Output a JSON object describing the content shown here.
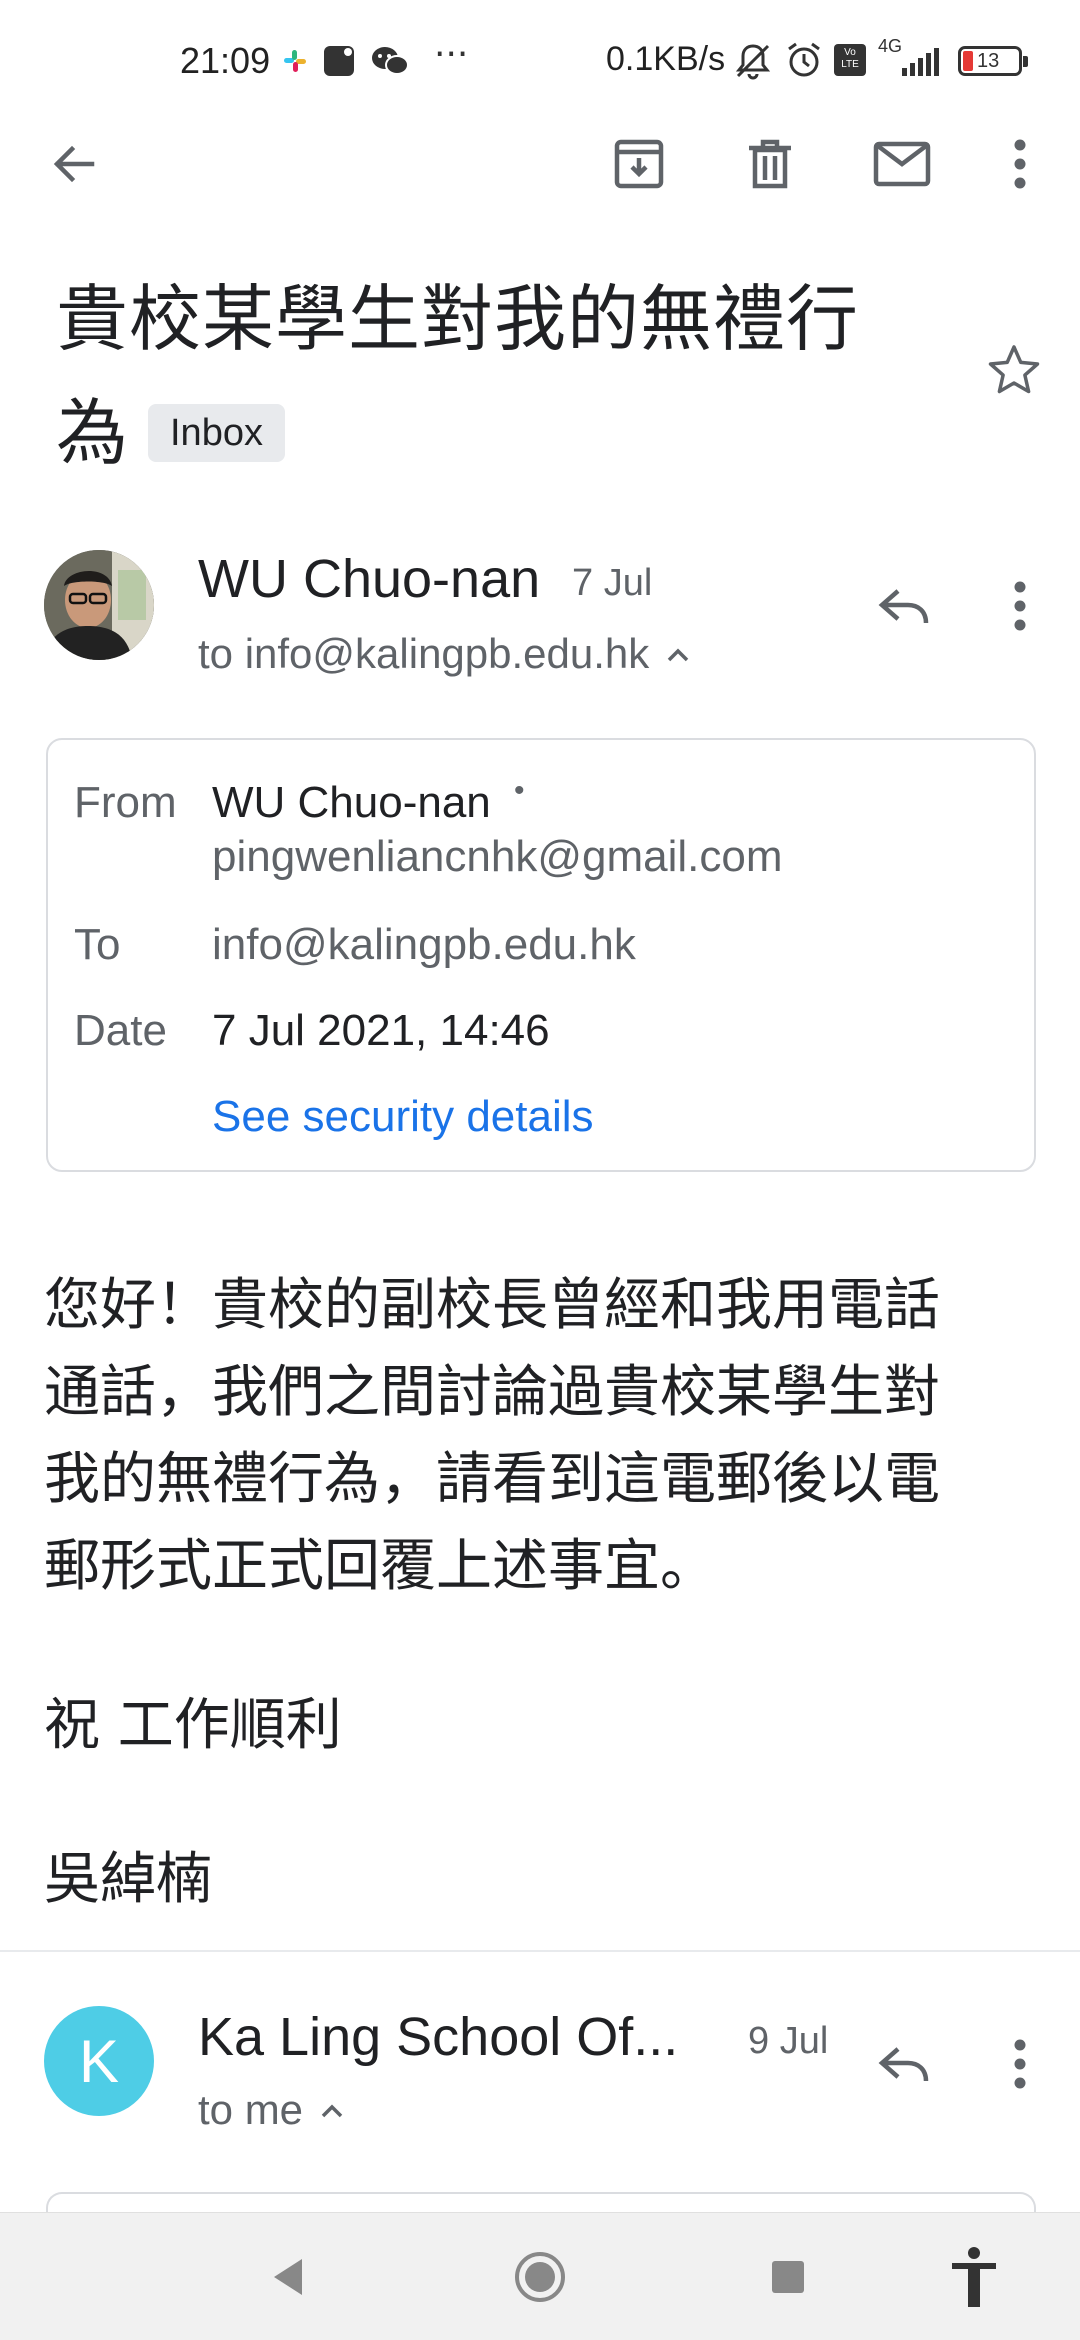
{
  "status_bar": {
    "time": "21:09",
    "more": "···",
    "net_speed": "0.1KB/s",
    "network": "4G",
    "volte": "Vo LTE",
    "battery": "13"
  },
  "toolbar": {
    "icons": [
      "back-arrow-icon",
      "archive-icon",
      "delete-icon",
      "mark-unread-icon",
      "more-vert-icon"
    ]
  },
  "subject": {
    "line1": "貴校某學生對我的無禮行",
    "line2": "為",
    "label": "Inbox"
  },
  "message1": {
    "sender_name": "WU Chuo-nan",
    "date": "7 Jul",
    "to_line": "to info@kalingpb.edu.hk",
    "details": {
      "from_label": "From",
      "from_name": "WU Chuo-nan",
      "from_dot": "•",
      "from_email": "pingwenliancnhk@gmail.com",
      "to_label": "To",
      "to_value": "info@kalingpb.edu.hk",
      "date_label": "Date",
      "date_value": "7 Jul 2021, 14:46",
      "security_link": "See security details"
    },
    "body_lines": [
      "您好！貴校的副校長曾經和我用電話",
      "通話，我們之間討論過貴校某學生對",
      "我的無禮行為，請看到這電郵後以電",
      "郵形式正式回覆上述事宜。"
    ],
    "closing": "祝 工作順利",
    "signature": "吳綽楠"
  },
  "message2": {
    "avatar_letter": "K",
    "sender_name": "Ka Ling School Of...",
    "date": "9 Jul",
    "to_line": "to me"
  },
  "colors": {
    "link": "#1a73e8",
    "secondary_text": "#5f6368",
    "avatar_k": "#4ecde6",
    "badge_bg": "#e8eaed"
  }
}
